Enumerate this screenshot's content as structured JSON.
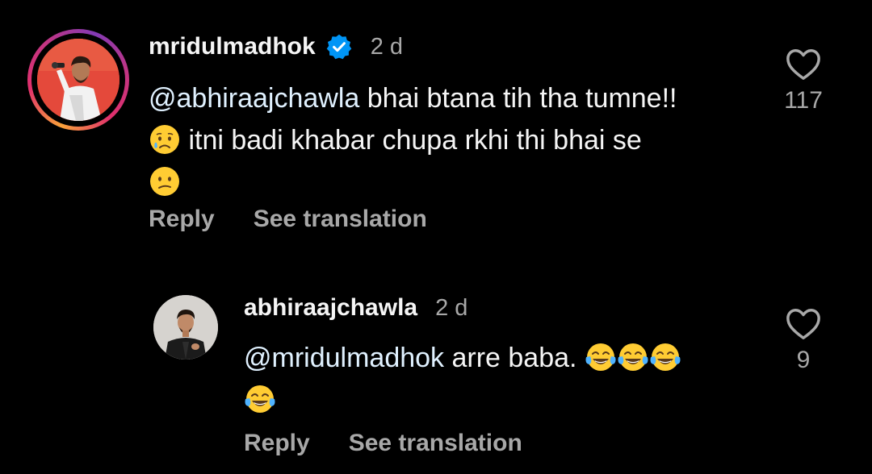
{
  "comments": [
    {
      "username": "mridulmadhok",
      "verified": true,
      "time": "2 d",
      "mention": "@abhiraajchawla",
      "line1_text": " bhai btana tih tha tumne!!",
      "line2_text": " itni badi khabar chupa rkhi thi bhai se",
      "emojis": [
        "sad-but-relieved-face",
        "confused-face"
      ],
      "reply_label": "Reply",
      "translate_label": "See translation",
      "likes": "117"
    },
    {
      "username": "abhiraajchawla",
      "verified": false,
      "time": "2 d",
      "mention": "@mridulmadhok",
      "line1_text": " arre baba. ",
      "emojis": [
        "face-with-tears-of-joy",
        "face-with-tears-of-joy",
        "face-with-tears-of-joy",
        "face-with-tears-of-joy"
      ],
      "reply_label": "Reply",
      "translate_label": "See translation",
      "likes": "9"
    }
  ],
  "colors": {
    "background": "#000000",
    "text": "#f5f5f5",
    "secondary": "#a8a8a8",
    "mention": "#e0f1ff",
    "verified": "#0095f6"
  },
  "icons": {
    "verified": "verified-badge-icon",
    "like": "heart-outline-icon"
  }
}
